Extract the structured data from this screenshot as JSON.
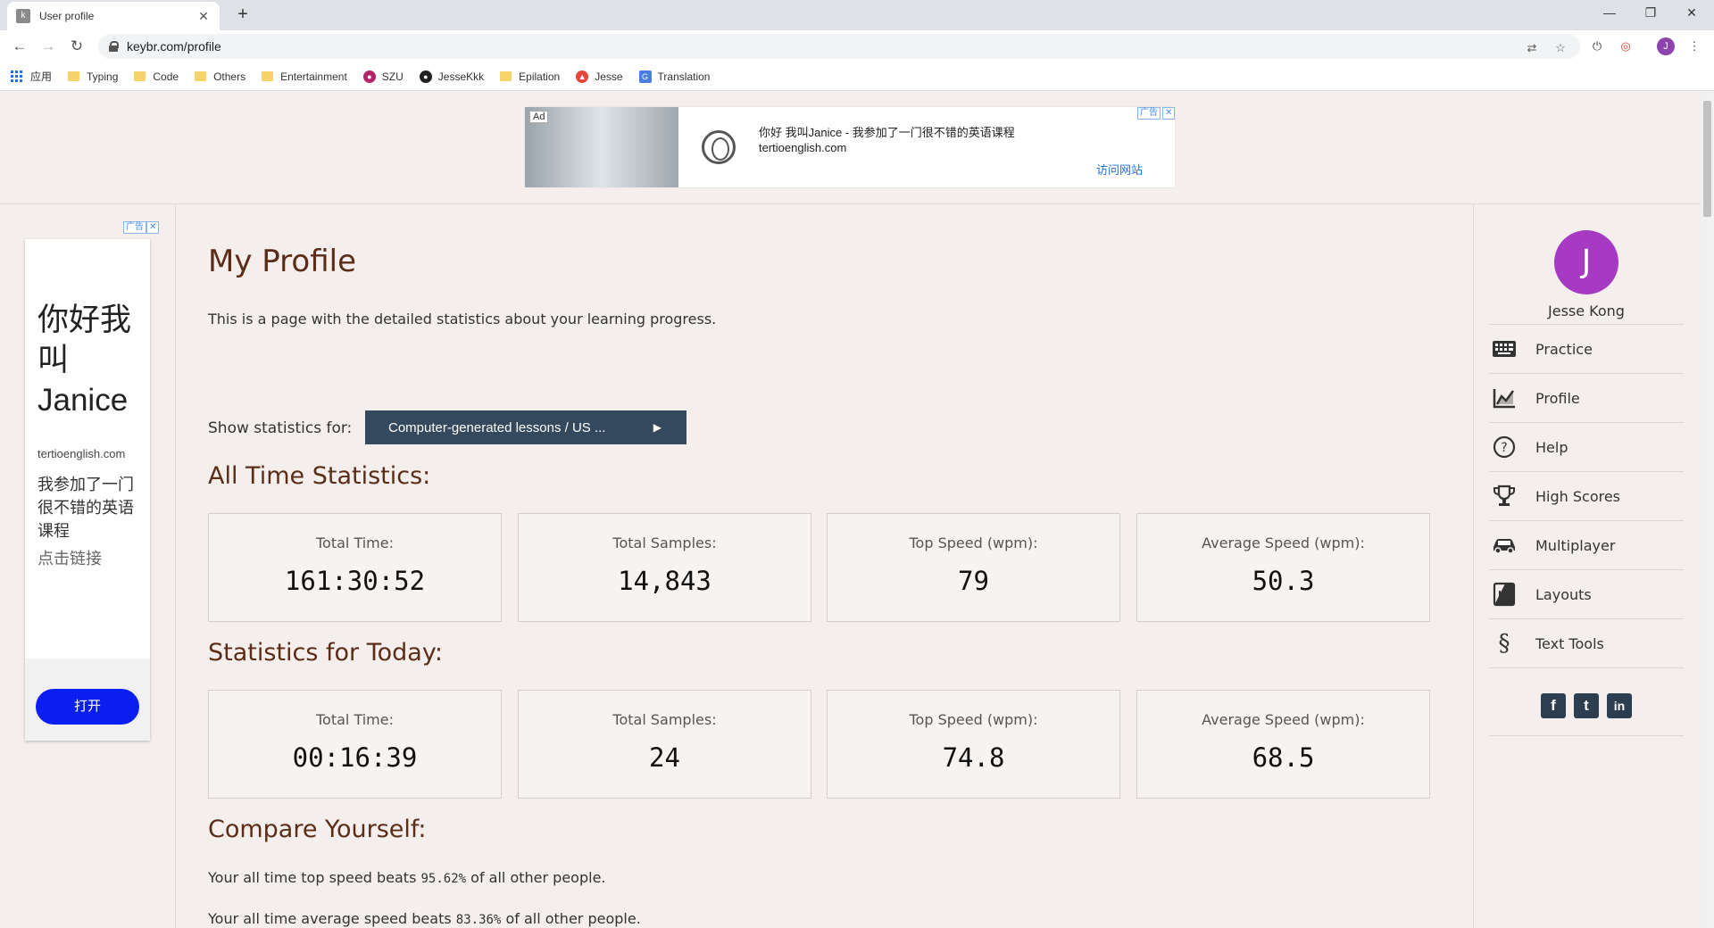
{
  "browser": {
    "tab_title": "User profile",
    "url": "keybr.com/profile",
    "bookmarks": [
      {
        "label": "应用",
        "type": "apps"
      },
      {
        "label": "Typing",
        "type": "folder"
      },
      {
        "label": "Code",
        "type": "folder"
      },
      {
        "label": "Others",
        "type": "folder"
      },
      {
        "label": "Entertainment",
        "type": "folder"
      },
      {
        "label": "SZU",
        "type": "site"
      },
      {
        "label": "JesseKkk",
        "type": "github"
      },
      {
        "label": "Epilation",
        "type": "folder"
      },
      {
        "label": "Jesse",
        "type": "site"
      },
      {
        "label": "Translation",
        "type": "site"
      }
    ],
    "profile_initial": "J"
  },
  "top_ad": {
    "tag": "Ad",
    "headline": "你好 我叫Janice - 我参加了一门很不错的英语课程",
    "domain": "tertioenglish.com",
    "visit": "访问网站",
    "badge": "广告"
  },
  "left_ad": {
    "badge": "广告",
    "headline": "你好我叫Janice",
    "domain": "tertioenglish.com",
    "description": "我参加了一门很不错的英语课程",
    "link": "点击链接",
    "button": "打开"
  },
  "main": {
    "title": "My Profile",
    "intro": "This is a page with the detailed statistics about your learning progress.",
    "show_label": "Show statistics for:",
    "select_value": "Computer-generated lessons / US ...",
    "all_time": {
      "title": "All Time Statistics:",
      "stats": [
        {
          "label": "Total Time:",
          "value": "161:30:52"
        },
        {
          "label": "Total Samples:",
          "value": "14,843"
        },
        {
          "label": "Top Speed (wpm):",
          "value": "79"
        },
        {
          "label": "Average Speed (wpm):",
          "value": "50.3"
        }
      ]
    },
    "today": {
      "title": "Statistics for Today:",
      "stats": [
        {
          "label": "Total Time:",
          "value": "00:16:39"
        },
        {
          "label": "Total Samples:",
          "value": "24"
        },
        {
          "label": "Top Speed (wpm):",
          "value": "74.8"
        },
        {
          "label": "Average Speed (wpm):",
          "value": "68.5"
        }
      ]
    },
    "compare": {
      "title": "Compare Yourself:",
      "top_prefix": "Your all time top speed beats",
      "top_pct": "95.62%",
      "top_suffix": "of all other people.",
      "avg_prefix": "Your all time average speed beats",
      "avg_pct": "83.36%",
      "avg_suffix": "of all other people."
    }
  },
  "sidebar": {
    "avatar_initial": "J",
    "user_name": "Jesse Kong",
    "items": [
      {
        "label": "Practice",
        "icon": "keyboard-icon"
      },
      {
        "label": "Profile",
        "icon": "chart-icon"
      },
      {
        "label": "Help",
        "icon": "help-icon"
      },
      {
        "label": "High Scores",
        "icon": "trophy-icon"
      },
      {
        "label": "Multiplayer",
        "icon": "car-icon"
      },
      {
        "label": "Layouts",
        "icon": "layouts-icon"
      },
      {
        "label": "Text Tools",
        "icon": "section-icon"
      }
    ],
    "social": [
      {
        "glyph": "f",
        "icon": "facebook-icon"
      },
      {
        "glyph": "t",
        "icon": "twitter-icon"
      },
      {
        "glyph": "in",
        "icon": "linkedin-icon"
      }
    ]
  },
  "colors": {
    "heading": "#5b2d16",
    "select_bg": "#34495e",
    "avatar": "#a63ac3",
    "ad_button": "#0b1ef2"
  }
}
